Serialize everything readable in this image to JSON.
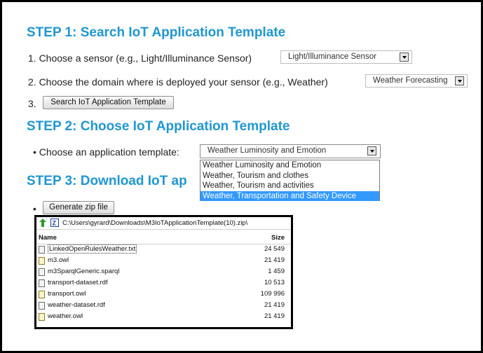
{
  "step1": {
    "heading": "STEP 1: Search IoT Application Template",
    "item1_text": "1. Choose a sensor (e.g., Light/Illuminance Sensor)",
    "sensor_select_value": "Light/Illuminance Sensor",
    "item2_text": "2. Choose the domain where is deployed your sensor (e.g., Weather)",
    "domain_select_value": "Weather Forecasting",
    "item3_number": "3.",
    "search_button_label": "Search IoT Application Template"
  },
  "step2": {
    "heading": "STEP 2: Choose IoT Application Template",
    "bullet_text": "• Choose an application template:",
    "template_select_value": "Weather Luminosity and Emotion",
    "options": [
      "Weather Luminosity and Emotion",
      "Weather, Tourism and clothes",
      "Weather, Tourism and activities",
      "Weather, Transportation and Safety Device"
    ],
    "highlighted_option_index": 3
  },
  "step3": {
    "heading": "STEP 3: Download IoT ap",
    "bullet": "•",
    "generate_button_label": "Generate zip file"
  },
  "zip_window": {
    "path": "C:\\Users\\gyrard\\Downloads\\M3IoTApplicationTemplate(10).zip\\",
    "col_name": "Name",
    "col_size": "Size",
    "files": [
      {
        "name": "LinkedOpenRulesWeather.txt",
        "size": "24 549",
        "icon": "text-file-icon"
      },
      {
        "name": "m3.owl",
        "size": "21 419",
        "icon": "owl-file-icon"
      },
      {
        "name": "m3SparqlGeneric.sparql",
        "size": "1 459",
        "icon": "generic-file-icon"
      },
      {
        "name": "transport-dataset.rdf",
        "size": "10 513",
        "icon": "rdf-file-icon"
      },
      {
        "name": "transport.owl",
        "size": "109 996",
        "icon": "owl-file-icon"
      },
      {
        "name": "weather-dataset.rdf",
        "size": "21 419",
        "icon": "rdf-file-icon"
      },
      {
        "name": "weather.owl",
        "size": "21 419",
        "icon": "owl-file-icon"
      }
    ]
  },
  "colors": {
    "heading": "#1f97d4",
    "highlight": "#3399ff"
  }
}
